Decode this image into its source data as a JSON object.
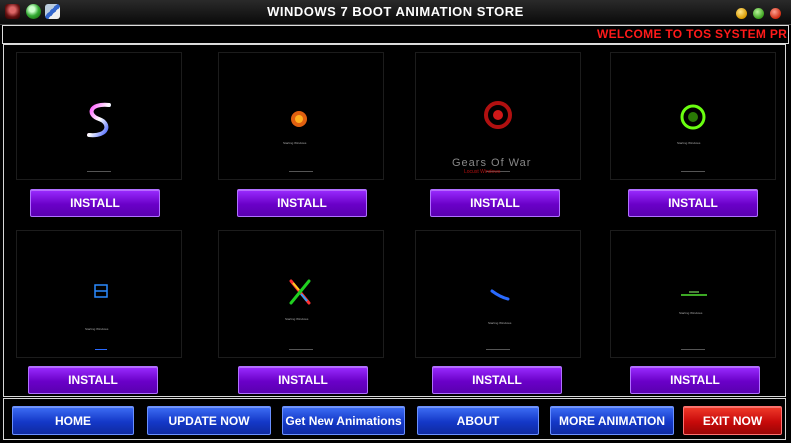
{
  "window": {
    "title": "WINDOWS 7 BOOT ANIMATION STORE"
  },
  "marquee": {
    "text": "WELCOME TO TOS SYSTEM PR"
  },
  "gallery": {
    "items": [
      {
        "install_label": "INSTALL",
        "caption": ""
      },
      {
        "install_label": "INSTALL",
        "caption": "Starting Windows"
      },
      {
        "install_label": "INSTALL",
        "caption": "Gears Of War",
        "subcaption": "Locust Windows"
      },
      {
        "install_label": "INSTALL",
        "caption": "Starting Windows"
      },
      {
        "install_label": "INSTALL",
        "caption": "Starting Windows"
      },
      {
        "install_label": "INSTALL",
        "caption": "Starting Windows"
      },
      {
        "install_label": "INSTALL",
        "caption": "Starting Windows"
      },
      {
        "install_label": "INSTALL",
        "caption": "Starting Windows"
      }
    ]
  },
  "nav": {
    "home": "HOME",
    "update": "UPDATE NOW",
    "get_new": "Get New Animations",
    "about": "ABOUT",
    "more": "MORE ANIMATION",
    "exit": "EXIT NOW"
  },
  "colors": {
    "install_purple": "#7a10e0",
    "nav_blue": "#1f4fe0",
    "exit_red": "#d81010",
    "marquee_red": "#ff1a1a"
  },
  "icons": [
    "app-icon",
    "globe-icon",
    "mail-icon",
    "minimize-icon",
    "maximize-icon",
    "close-icon"
  ]
}
